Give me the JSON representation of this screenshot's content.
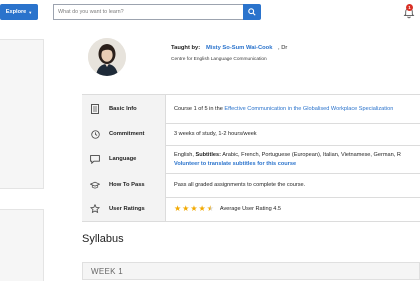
{
  "header": {
    "explore_label": "Explore",
    "search_placeholder": "What do you want to learn?",
    "notification_count": "1"
  },
  "instructor": {
    "taught_by_label": "Taught by:",
    "name": "Misty So-Sum Wai-Cook",
    "suffix": ", Dr",
    "organization": "Centre for English Language Communication"
  },
  "info_rows": [
    {
      "label": "Basic Info",
      "text_prefix": "Course 1 of 5 in the ",
      "link": "Effective Communication in the Globalised Workplace Specialization"
    },
    {
      "label": "Commitment",
      "text": "3 weeks of study, 1-2 hours/week"
    },
    {
      "label": "Language",
      "text_prefix": "English, ",
      "subtitles_label": "Subtitles:",
      "subtitles": " Arabic, French, Portuguese (European), Italian, Vietnamese, German, R",
      "volunteer_link": "Volunteer to translate subtitles for this course"
    },
    {
      "label": "How To Pass",
      "text": "Pass all graded assignments to complete the course."
    },
    {
      "label": "User Ratings",
      "rating_text": "Average User Rating 4.5",
      "rating": 4.5
    }
  ],
  "syllabus": {
    "title": "Syllabus",
    "week_label": "WEEK 1"
  },
  "colors": {
    "accent": "#2a73cc",
    "star": "#f2a900",
    "badge": "#d93025"
  }
}
